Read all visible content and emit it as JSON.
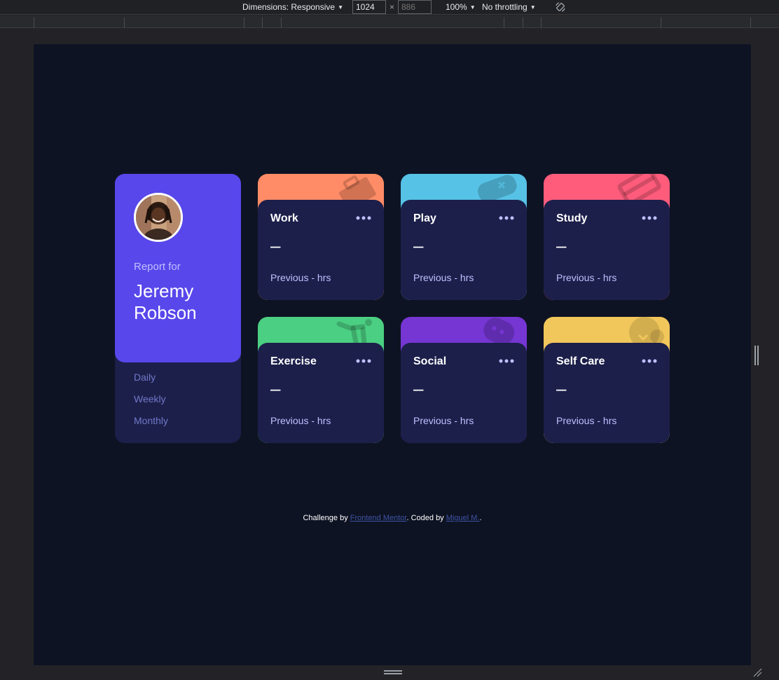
{
  "devtools": {
    "dimensions_label": "Dimensions: Responsive",
    "width_value": "1024",
    "times": "×",
    "height_placeholder": "886",
    "zoom": "100%",
    "throttling": "No throttling"
  },
  "profile": {
    "report_for": "Report for",
    "name": "Jeremy Robson",
    "periods": [
      "Daily",
      "Weekly",
      "Monthly"
    ]
  },
  "cards": [
    {
      "title": "Work",
      "current": "–",
      "previous": "Previous - hrs",
      "color": "#ff8c66",
      "icon": "briefcase-icon"
    },
    {
      "title": "Play",
      "current": "–",
      "previous": "Previous - hrs",
      "color": "#56c2e6",
      "icon": "gamepad-icon"
    },
    {
      "title": "Study",
      "current": "–",
      "previous": "Previous - hrs",
      "color": "#ff5c7c",
      "icon": "book-icon"
    },
    {
      "title": "Exercise",
      "current": "–",
      "previous": "Previous - hrs",
      "color": "#4bcf82",
      "icon": "runner-icon"
    },
    {
      "title": "Social",
      "current": "–",
      "previous": "Previous - hrs",
      "color": "#7536d3",
      "icon": "chat-icon"
    },
    {
      "title": "Self Care",
      "current": "–",
      "previous": "Previous - hrs",
      "color": "#f1c65b",
      "icon": "heart-icon"
    }
  ],
  "footer": {
    "prefix": "Challenge by ",
    "link1": "Frontend Mentor",
    "middle": ". Coded by ",
    "link2": "Miguel M.",
    "suffix": "."
  },
  "colors": {
    "background": "#0e1323",
    "card_body": "#1c1f4a",
    "profile": "#5847eb",
    "period_text": "#7078c9",
    "pale_blue": "#bdc1ff"
  }
}
